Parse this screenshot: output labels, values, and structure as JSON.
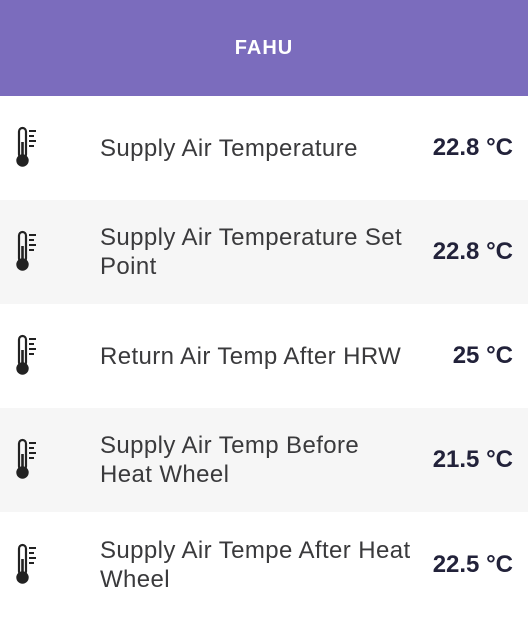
{
  "header": {
    "title": "FAHU"
  },
  "items": [
    {
      "label": "Supply Air Temperature",
      "value": "22.8 °C",
      "icon": "thermometer-icon"
    },
    {
      "label": "Supply Air Temperature Set Point",
      "value": "22.8 °C",
      "icon": "thermometer-icon"
    },
    {
      "label": "Return Air Temp After HRW",
      "value": "25 °C",
      "icon": "thermometer-icon"
    },
    {
      "label": "Supply Air Temp Before Heat Wheel",
      "value": "21.5 °C",
      "icon": "thermometer-icon"
    },
    {
      "label": "Supply Air Tempe After Heat Wheel",
      "value": "22.5 °C",
      "icon": "thermometer-icon"
    }
  ],
  "colors": {
    "header_bg": "#7b6cbd",
    "header_text": "#ffffff",
    "row_alt_bg": "#f6f6f6"
  }
}
